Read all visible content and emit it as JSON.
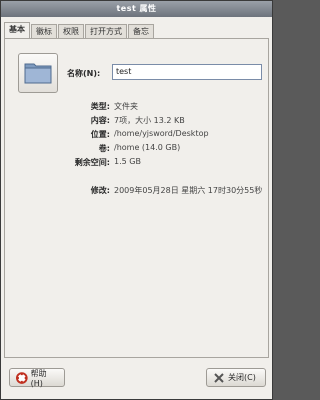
{
  "window": {
    "title": "test 属性"
  },
  "tabs": [
    {
      "label": "基本",
      "active": true
    },
    {
      "label": "徽标"
    },
    {
      "label": "权限"
    },
    {
      "label": "打开方式"
    },
    {
      "label": "备忘"
    }
  ],
  "basic": {
    "name_label": "名称(N):",
    "name_value": "test",
    "rows": [
      {
        "label": "类型:",
        "value": "文件夹"
      },
      {
        "label": "内容:",
        "value": "7项，大小 13.2 KB"
      },
      {
        "label": "位置:",
        "value": "/home/yjsword/Desktop"
      },
      {
        "label": "卷:",
        "value": "/home (14.0 GB)"
      },
      {
        "label": "剩余空间:",
        "value": "1.5 GB"
      },
      {
        "label": "修改:",
        "value": "2009年05月28日 星期六 17时30分55秒"
      }
    ]
  },
  "buttons": {
    "help": "帮助(H)",
    "close": "关闭(C)"
  },
  "icons": {
    "folder": "folder-icon",
    "help": "lifebuoy-help-icon",
    "close": "close-x-icon"
  }
}
